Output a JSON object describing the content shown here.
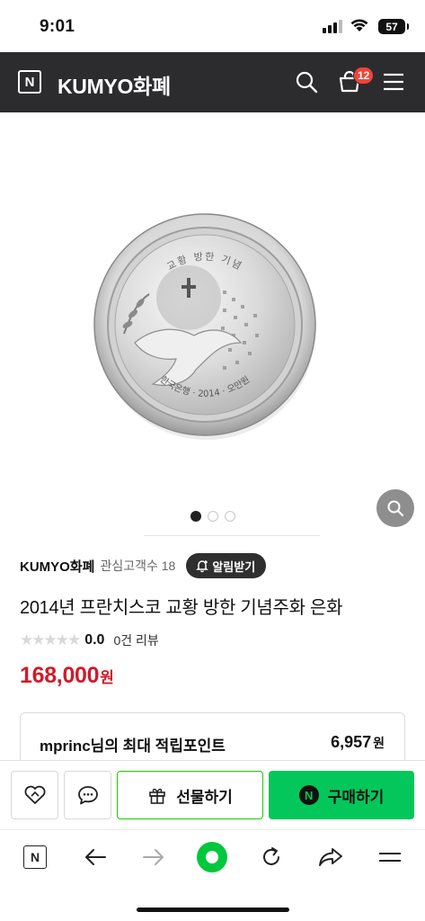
{
  "status_bar": {
    "time": "9:01",
    "battery": "57"
  },
  "header": {
    "logo_letter": "N",
    "store_name": "KUMYO화폐",
    "cart_count": "12",
    "icons": [
      "search-icon",
      "cart-icon",
      "menu-icon"
    ]
  },
  "gallery": {
    "coin_text_top": "교황 방한 기념",
    "coin_text_bottom": "한국은행 · 2014 · 오만원",
    "image_count": 3,
    "active_index": 0
  },
  "product": {
    "seller_name": "KUMYO화폐",
    "followers_label": "관심고객수 18",
    "alarm_button": "알림받기",
    "title": "2014년 프란치스코 교황 방한 기념주화 은화",
    "rating": 0.0,
    "rating_text": "0.0",
    "reviews_label": "0건 리뷰",
    "price": "168,000",
    "price_unit": "원"
  },
  "points": {
    "label": "mprinc님의 최대 적립포인트",
    "value": "6,957",
    "unit": "원"
  },
  "action_bar": {
    "gift_label": "선물하기",
    "buy_logo": "N",
    "buy_label": "구매하기"
  },
  "browser_bar": {
    "logo_letter": "N",
    "icons": [
      "naver-home-icon",
      "back-arrow-icon",
      "forward-arrow-icon",
      "green-dot-icon",
      "reload-icon",
      "share-icon",
      "hamburger-menu-icon"
    ]
  },
  "colors": {
    "header_bg": "#2c2c2e",
    "price": "#d01b2a",
    "buy_green": "#03c75a",
    "gift_border": "#1ec800",
    "badge": "#f44336"
  }
}
